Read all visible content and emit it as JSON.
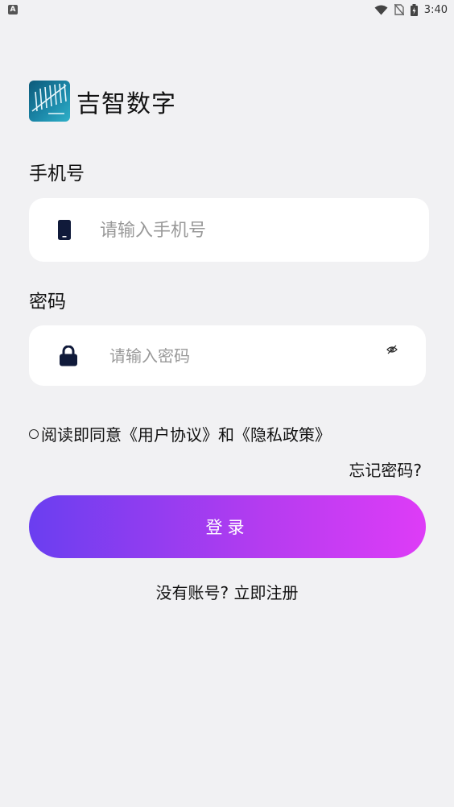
{
  "status_bar": {
    "left_badge": "A",
    "time": "3:40",
    "icons": [
      "wifi-icon",
      "no-sim-icon",
      "battery-charging-icon"
    ]
  },
  "brand": {
    "name": "吉智数字",
    "logo_icon": "app-logo-icon"
  },
  "phone": {
    "label": "手机号",
    "placeholder": "请输入手机号",
    "value": "",
    "icon": "phone-icon"
  },
  "password": {
    "label": "密码",
    "placeholder": "请输入密码",
    "value": "",
    "icon": "lock-icon",
    "toggle_icon": "eye-off-icon"
  },
  "agreement": {
    "prefix": "阅读即同意",
    "user_agreement": "《用户协议》",
    "and": "和",
    "privacy_policy": "《隐私政策》",
    "checked": false
  },
  "forgot_password": "忘记密码?",
  "login_button": "登录",
  "register": {
    "prompt": "没有账号?",
    "link": " 立即注册"
  },
  "colors": {
    "background": "#f1f1f3",
    "button_gradient_start": "#6a3ef0",
    "button_gradient_end": "#de3cf7",
    "icon": "#101a3a"
  }
}
